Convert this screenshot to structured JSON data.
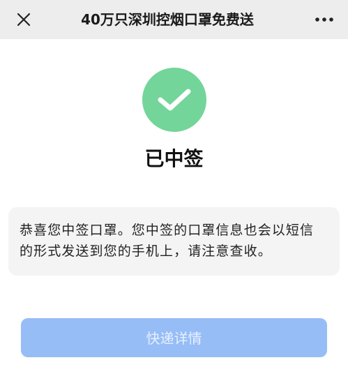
{
  "header": {
    "title": "40万只深圳控烟口罩免费送",
    "close_icon": "close-icon",
    "more_icon": "more-icon"
  },
  "status": {
    "icon": "check-icon",
    "icon_color": "#73d59a",
    "title": "已中签"
  },
  "notice": {
    "text": "恭喜您中签口罩。您中签的口罩信息也会以短信的形式发送到您的手机上，请注意查收。"
  },
  "actions": {
    "express_details_label": "快递详情",
    "button_color": "#96bdf6"
  }
}
